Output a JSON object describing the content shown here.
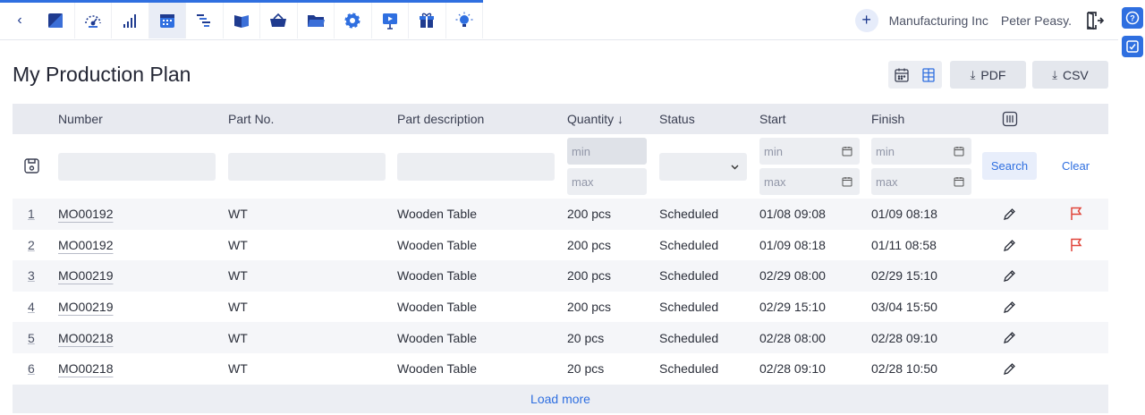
{
  "nav": {
    "back_glyph": "‹",
    "icons": [
      {
        "name": "dashboard-icon"
      },
      {
        "name": "gauge-icon"
      },
      {
        "name": "signal-bars-icon"
      },
      {
        "name": "calendar-icon",
        "active": true
      },
      {
        "name": "gantt-icon"
      },
      {
        "name": "book-icon"
      },
      {
        "name": "basket-icon"
      },
      {
        "name": "folder-icon"
      },
      {
        "name": "gear-icon"
      },
      {
        "name": "presentation-icon"
      },
      {
        "name": "gift-icon"
      },
      {
        "name": "lightbulb-icon"
      }
    ],
    "plus_glyph": "+",
    "company": "Manufacturing Inc",
    "user": "Peter Peasy."
  },
  "side": {
    "help_glyph": "?"
  },
  "page": {
    "title": "My Production Plan",
    "pdf_label": "PDF",
    "csv_label": "CSV",
    "download_glyph": "⤓"
  },
  "table": {
    "headers": {
      "number": "Number",
      "part_no": "Part No.",
      "part_description": "Part description",
      "quantity": "Quantity ↓",
      "status": "Status",
      "start": "Start",
      "finish": "Finish"
    },
    "filters": {
      "qty_min": "min",
      "qty_max": "max",
      "start_min": "min",
      "start_max": "max",
      "finish_min": "min",
      "finish_max": "max",
      "search_label": "Search",
      "clear_label": "Clear"
    },
    "rows": [
      {
        "idx": "1",
        "number": "MO00192",
        "part_no": "WT",
        "desc": "Wooden Table",
        "qty": "200 pcs",
        "status": "Scheduled",
        "start": "01/08 09:08",
        "finish": "01/09 08:18",
        "flag": true
      },
      {
        "idx": "2",
        "number": "MO00192",
        "part_no": "WT",
        "desc": "Wooden Table",
        "qty": "200 pcs",
        "status": "Scheduled",
        "start": "01/09 08:18",
        "finish": "01/11 08:58",
        "flag": true
      },
      {
        "idx": "3",
        "number": "MO00219",
        "part_no": "WT",
        "desc": "Wooden Table",
        "qty": "200 pcs",
        "status": "Scheduled",
        "start": "02/29 08:00",
        "finish": "02/29 15:10",
        "flag": false
      },
      {
        "idx": "4",
        "number": "MO00219",
        "part_no": "WT",
        "desc": "Wooden Table",
        "qty": "200 pcs",
        "status": "Scheduled",
        "start": "02/29 15:10",
        "finish": "03/04 15:50",
        "flag": false
      },
      {
        "idx": "5",
        "number": "MO00218",
        "part_no": "WT",
        "desc": "Wooden Table",
        "qty": "20 pcs",
        "status": "Scheduled",
        "start": "02/28 08:00",
        "finish": "02/28 09:10",
        "flag": false
      },
      {
        "idx": "6",
        "number": "MO00218",
        "part_no": "WT",
        "desc": "Wooden Table",
        "qty": "20 pcs",
        "status": "Scheduled",
        "start": "02/28 09:10",
        "finish": "02/28 10:50",
        "flag": false
      }
    ],
    "load_more": "Load more"
  },
  "colors": {
    "accent": "#2f6fe0",
    "nav_dark": "#1f3b8f",
    "flag_red": "#e0443a"
  }
}
